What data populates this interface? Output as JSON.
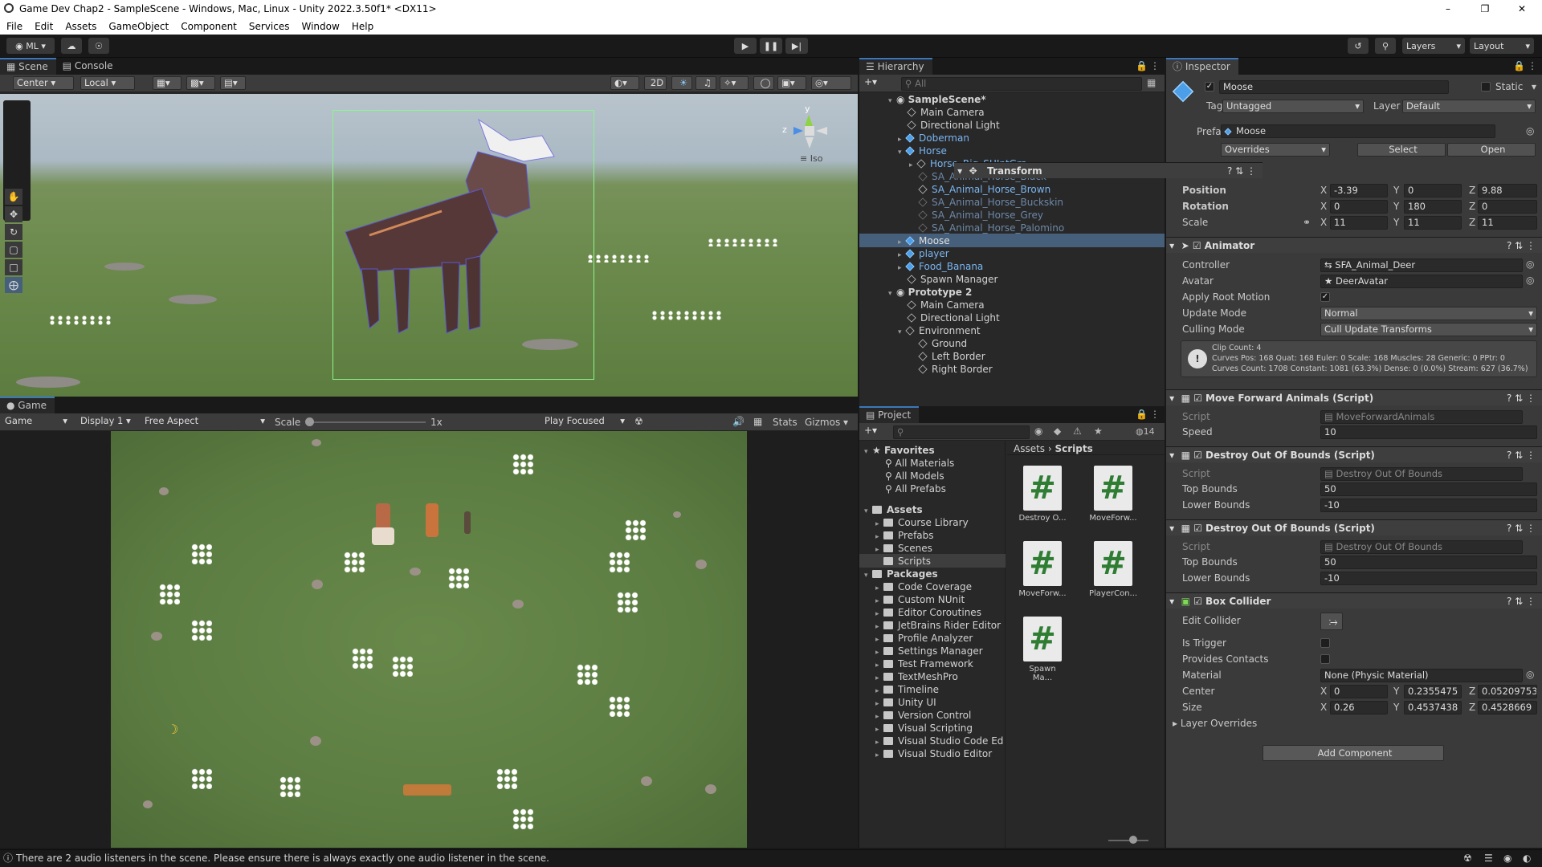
{
  "window": {
    "title": "Game Dev Chap2 - SampleScene - Windows, Mac, Linux - Unity 2022.3.50f1* <DX11>"
  },
  "menu": [
    "File",
    "Edit",
    "Assets",
    "GameObject",
    "Component",
    "Services",
    "Window",
    "Help"
  ],
  "toolbar": {
    "account": "ML",
    "layers": "Layers",
    "layout": "Layout"
  },
  "scene": {
    "tabs": [
      "Scene",
      "Console"
    ],
    "pivot": "Center",
    "space": "Local",
    "mode2d": "2D",
    "iso": "Iso",
    "gizmo_axes": {
      "y": "y",
      "z": "z"
    }
  },
  "game": {
    "tab": "Game",
    "mode": "Game",
    "display": "Display 1",
    "aspect": "Free Aspect",
    "scale_label": "Scale",
    "scale_value": "1x",
    "play_focused": "Play Focused",
    "stats": "Stats",
    "gizmos": "Gizmos"
  },
  "hierarchy": {
    "tab": "Hierarchy",
    "search_placeholder": "All",
    "items": [
      {
        "label": "SampleScene*",
        "style": "scene"
      },
      {
        "label": "Main Camera",
        "style": "normal"
      },
      {
        "label": "Directional Light",
        "style": "normal"
      },
      {
        "label": "Doberman",
        "style": "prefab"
      },
      {
        "label": "Horse",
        "style": "prefab"
      },
      {
        "label": "Horse_Rig_SHJntGrp",
        "style": "prefab"
      },
      {
        "label": "SA_Animal_Horse_Black",
        "style": "disabled"
      },
      {
        "label": "SA_Animal_Horse_Brown",
        "style": "prefab"
      },
      {
        "label": "SA_Animal_Horse_Buckskin",
        "style": "disabled"
      },
      {
        "label": "SA_Animal_Horse_Grey",
        "style": "disabled"
      },
      {
        "label": "SA_Animal_Horse_Palomino",
        "style": "disabled"
      },
      {
        "label": "Moose",
        "style": "prefab"
      },
      {
        "label": "player",
        "style": "prefab"
      },
      {
        "label": "Food_Banana",
        "style": "prefab"
      },
      {
        "label": "Spawn Manager",
        "style": "normal"
      },
      {
        "label": "Prototype 2",
        "style": "scene"
      },
      {
        "label": "Main Camera",
        "style": "normal"
      },
      {
        "label": "Directional Light",
        "style": "normal"
      },
      {
        "label": "Environment",
        "style": "normal"
      },
      {
        "label": "Ground",
        "style": "normal"
      },
      {
        "label": "Left Border",
        "style": "normal"
      },
      {
        "label": "Right Border",
        "style": "normal"
      }
    ]
  },
  "project": {
    "tab": "Project",
    "count": "14",
    "breadcrumb": [
      "Assets",
      "Scripts"
    ],
    "favorites": {
      "label": "Favorites",
      "items": [
        "All Materials",
        "All Models",
        "All Prefabs"
      ]
    },
    "assets": {
      "label": "Assets",
      "items": [
        "Course Library",
        "Prefabs",
        "Scenes",
        "Scripts"
      ]
    },
    "packages": {
      "label": "Packages",
      "items": [
        "Code Coverage",
        "Custom NUnit",
        "Editor Coroutines",
        "JetBrains Rider Editor",
        "Profile Analyzer",
        "Settings Manager",
        "Test Framework",
        "TextMeshPro",
        "Timeline",
        "Unity UI",
        "Version Control",
        "Visual Scripting",
        "Visual Studio Code Edito",
        "Visual Studio Editor"
      ]
    },
    "scripts": [
      "Destroy O...",
      "MoveForw...",
      "MoveForw...",
      "PlayerCon...",
      "Spawn Ma..."
    ]
  },
  "inspector": {
    "tab": "Inspector",
    "object_name": "Moose",
    "static_label": "Static",
    "tag_label": "Tag",
    "tag": "Untagged",
    "layer_label": "Layer",
    "layer": "Default",
    "prefab_label": "Prefab",
    "prefab": "Moose",
    "overrides": "Overrides",
    "select": "Select",
    "open": "Open",
    "transform": {
      "title": "Transform",
      "position_label": "Position",
      "rotation_label": "Rotation",
      "scale_label": "Scale",
      "position": [
        "-3.39",
        "0",
        "9.88"
      ],
      "rotation": [
        "0",
        "180",
        "0"
      ],
      "scale": [
        "11",
        "11",
        "11"
      ]
    },
    "animator": {
      "title": "Animator",
      "controller_label": "Controller",
      "controller": "SFA_Animal_Deer",
      "avatar_label": "Avatar",
      "avatar": "DeerAvatar",
      "root_motion_label": "Apply Root Motion",
      "update_mode_label": "Update Mode",
      "update_mode": "Normal",
      "culling_label": "Culling Mode",
      "culling": "Cull Update Transforms",
      "info": [
        "Clip Count: 4",
        "Curves Pos: 168 Quat: 168 Euler: 0 Scale: 168 Muscles: 28 Generic: 0 PPtr: 0",
        "Curves Count: 1708 Constant: 1081 (63.3%) Dense: 0 (0.0%) Stream: 627 (36.7%)"
      ]
    },
    "move_forward": {
      "title": "Move Forward Animals (Script)",
      "script_label": "Script",
      "script": "MoveForwardAnimals",
      "speed_label": "Speed",
      "speed": "10"
    },
    "destroy1": {
      "title": "Destroy Out Of Bounds (Script)",
      "script_label": "Script",
      "script": "Destroy Out Of Bounds",
      "top_label": "Top Bounds",
      "top": "50",
      "lower_label": "Lower Bounds",
      "lower": "-10"
    },
    "destroy2": {
      "title": "Destroy Out Of Bounds (Script)",
      "script_label": "Script",
      "script": "Destroy Out Of Bounds",
      "top_label": "Top Bounds",
      "top": "50",
      "lower_label": "Lower Bounds",
      "lower": "-10"
    },
    "box": {
      "title": "Box Collider",
      "edit_label": "Edit Collider",
      "trigger_label": "Is Trigger",
      "contacts_label": "Provides Contacts",
      "material_label": "Material",
      "material": "None (Physic Material)",
      "center_label": "Center",
      "center": [
        "0",
        "0.2355475",
        "0.05209753"
      ],
      "size_label": "Size",
      "size": [
        "0.26",
        "0.4537438",
        "0.4528669"
      ],
      "layer_overrides": "Layer Overrides"
    },
    "add_component": "Add Component"
  },
  "status": {
    "message": "There are 2 audio listeners in the scene. Please ensure there is always exactly one audio listener in the scene."
  },
  "axis_letters": {
    "x": "X",
    "y": "Y",
    "z": "Z"
  },
  "hash": "#"
}
